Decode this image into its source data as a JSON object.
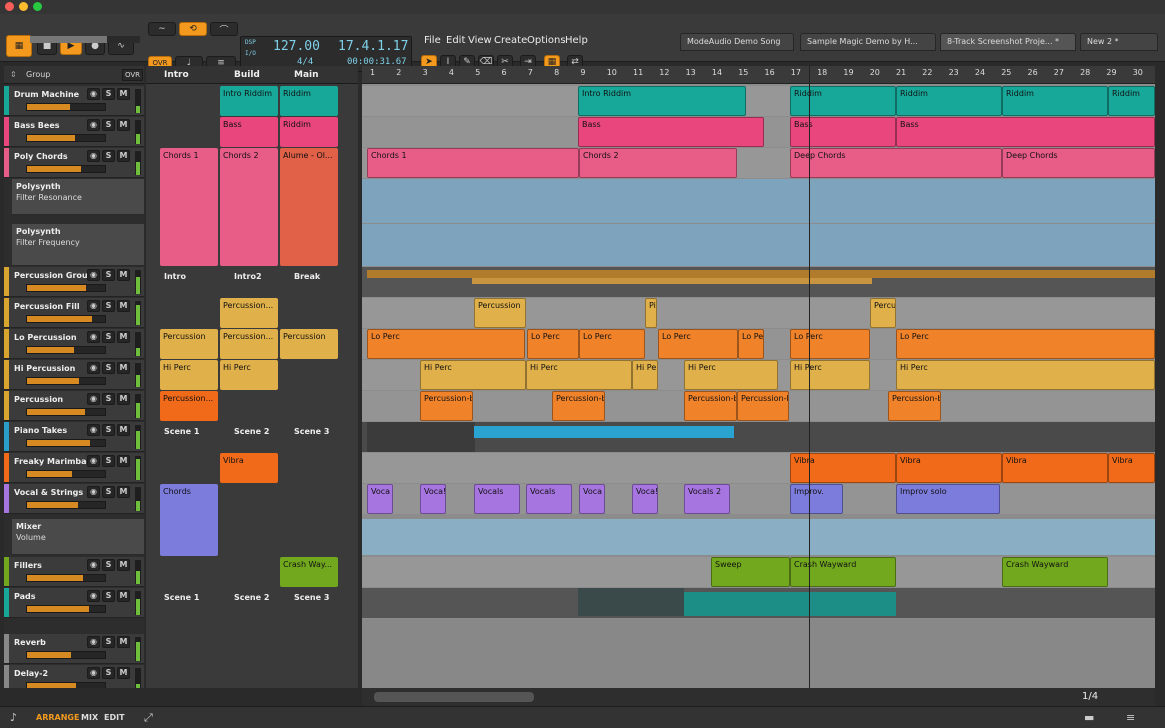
{
  "toolbar": {
    "tempo": "127.00",
    "position": "17.4.1.17",
    "signature": "4/4",
    "time": "00:00:31.67",
    "ovr": "OVR",
    "dsp": "DSP",
    "io": "I/O"
  },
  "menu": [
    "File",
    "Edit",
    "View",
    "Create",
    "Options",
    "Help"
  ],
  "tabs": [
    "ModeAudio Demo Song",
    "Sample Magic Demo by H...",
    "8-Track Screenshot Proje... *",
    "New 2 *"
  ],
  "tracklist": {
    "header": "Group",
    "ovr": "OVR"
  },
  "tracks": [
    {
      "name": "Drum Machine",
      "color": "#17a89a"
    },
    {
      "name": "Bass Bees",
      "color": "#e8467d"
    },
    {
      "name": "Poly Chords",
      "color": "#e85d88"
    },
    {
      "name": "Percussion Group",
      "color": "#d8a62e"
    },
    {
      "name": "Percussion Fill",
      "color": "#d8a62e"
    },
    {
      "name": "Lo Percussion",
      "color": "#d8a62e"
    },
    {
      "name": "Hi Percussion",
      "color": "#d8a62e"
    },
    {
      "name": "Percussion",
      "color": "#d8a62e"
    },
    {
      "name": "Piano Takes",
      "color": "#2a9dc8"
    },
    {
      "name": "Freaky Marimba",
      "color": "#f06a1a"
    },
    {
      "name": "Vocal & Strings",
      "color": "#a775e0"
    },
    {
      "name": "Fillers",
      "color": "#72a81e"
    },
    {
      "name": "Pads",
      "color": "#17a89a"
    },
    {
      "name": "Reverb",
      "color": "#888888"
    },
    {
      "name": "Delay-2",
      "color": "#888888"
    }
  ],
  "automation": [
    {
      "device": "Polysynth",
      "param": "Filter Resonance"
    },
    {
      "device": "Polysynth",
      "param": "Filter Frequency"
    },
    {
      "device": "Mixer",
      "param": "Volume"
    }
  ],
  "scenes": {
    "c1": "Intro",
    "c2": "Build",
    "c3": "Main",
    "intro": "Intro",
    "intro2": "Intro2",
    "break": "Break",
    "scene1": "Scene 1",
    "scene2": "Scene 2",
    "scene3": "Scene 3"
  },
  "launcher_clips": {
    "intro_riddim": "Intro Riddim",
    "riddim": "Riddim",
    "bass": "Bass",
    "chords1": "Chords 1",
    "chords2": "Chords 2",
    "alume": "Alume - Ol...",
    "percussion": "Percussion...",
    "percussion2": "Percussion",
    "hiperc": "Hi Perc",
    "vibra": "Vibra",
    "chords": "Chords",
    "crash": "Crash Way..."
  },
  "arrangement_clips": {
    "intro_riddim": "Intro Riddim",
    "riddim": "Riddim",
    "bass": "Bass",
    "chords1": "Chords 1",
    "chords2": "Chords 2",
    "deep": "Deep Chords",
    "percussion": "Percussion",
    "p": "Pi",
    "perc": "Percu",
    "lo": "Lo Perc",
    "lope": "Lo Pe",
    "hi": "Hi Perc",
    "hipe": "Hi Pe",
    "pb": "Percussion-b",
    "vibra": "Vibra",
    "voca": "Voca",
    "vocal": "Voca!",
    "vocals": "Vocals",
    "vocals2": "Vocals 2",
    "improv": "Improv.",
    "improvsolo": "Improv solo",
    "sweep": "Sweep",
    "crash": "Crash Wayward"
  },
  "bars": [
    "1",
    "2",
    "3",
    "4",
    "5",
    "6",
    "7",
    "8",
    "9",
    "10",
    "11",
    "12",
    "13",
    "14",
    "15",
    "16",
    "17",
    "18",
    "19",
    "20",
    "21",
    "22",
    "23",
    "24",
    "25",
    "26",
    "27",
    "28",
    "29",
    "30"
  ],
  "bottom": {
    "arrange": "ARRANGE",
    "mix": "MIX",
    "edit": "EDIT",
    "zoom": "1/4"
  }
}
